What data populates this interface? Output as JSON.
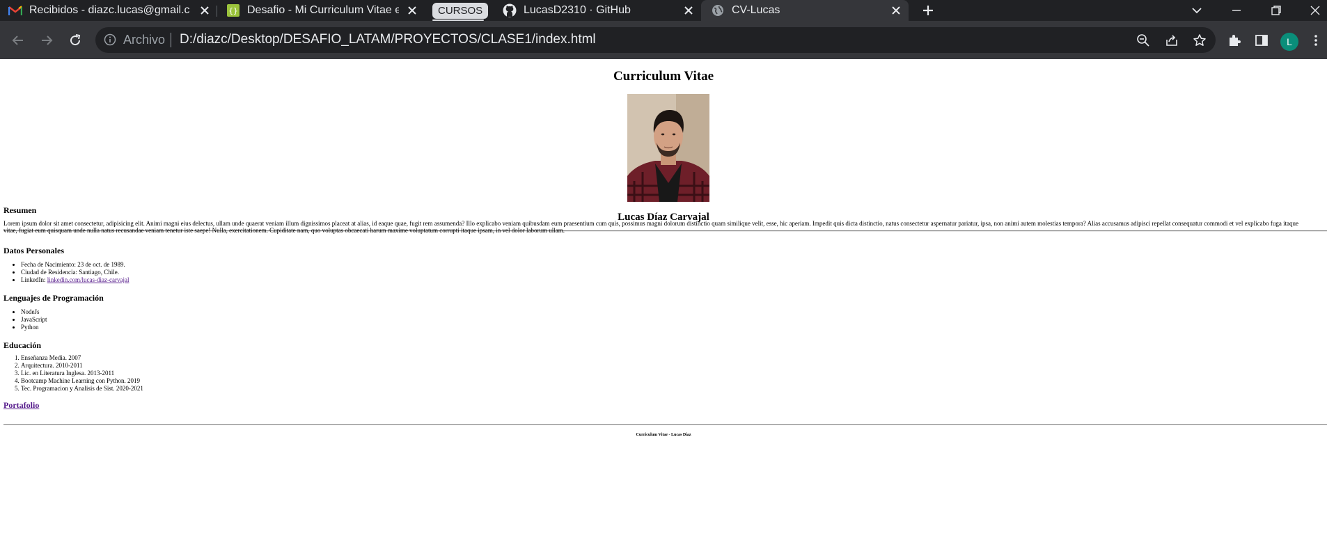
{
  "browser": {
    "tabs": [
      {
        "label": "Recibidos - diazc.lucas@gmail.com",
        "icon": "gmail-icon"
      },
      {
        "label": "Desafio - Mi Curriculum Vitae en",
        "icon": "desafio-latam-icon"
      },
      {
        "label": "LucasD2310 · GitHub",
        "icon": "github-icon"
      },
      {
        "label": "CV-Lucas",
        "icon": "globe-icon"
      }
    ],
    "tab_group_label": "CURSOS",
    "address": {
      "scheme_label": "Archivo",
      "url": "D:/diazc/Desktop/DESAFIO_LATAM/PROYECTOS/CLASE1/index.html"
    },
    "profile_initial": "L",
    "colors": {
      "tabbar": "#202124",
      "toolbar": "#35363a",
      "avatar": "#0a8e7a",
      "link_visited": "#551a8b"
    }
  },
  "cv": {
    "title": "Curriculum Vitae",
    "name": "Lucas Díaz Carvajal",
    "resumen": {
      "heading": "Resumen",
      "text": "Lorem ipsum dolor sit amet consectetur, adipisicing elit. Animi magni eius delectus, ullam unde quaerat veniam illum dignissimos placeat at alias, id eaque quae, fugit rem assumenda? Illo explicabo veniam quibusdam eum praesentium cum quis, possimus magni dolorum distinctio quam similique velit, esse, hic aperiam. Impedit quis dicta distinctio, natus consectetur aspernatur pariatur, ipsa, non animi autem molestias tempora? Alias accusamus adipisci repellat consequatur commodi et vel explicabo fuga itaque vitae, fugiat eum quisquam unde nulla natus recusandae veniam tenetur iste saepe! Nulla, exercitationem. Cupiditate nam, quo voluptas obcaecati harum maxime voluptatum corrupti itaque ipsam, in vel dolor laborum ullam."
    },
    "datos": {
      "heading": "Datos Personales",
      "nacimiento": "Fecha de Nacimiento: 23 de oct. de 1989.",
      "ciudad": "Ciudad de Residencia: Santiago, Chile.",
      "linkedin_label": "LinkedIn: ",
      "linkedin_link": "linkedin.com/lucas-diaz-carvajal"
    },
    "lenguajes": {
      "heading": "Lenguajes de Programación",
      "items": [
        "NodeJs",
        "JavaScript",
        "Python"
      ]
    },
    "educacion": {
      "heading": "Educación",
      "items": [
        "Enseñanza Media. 2007",
        "Arquitectura. 2010-2011",
        "Lic. en Literatura Inglesa. 2013-2011",
        "Bootcamp Machine Learning con Python. 2019",
        "Tec. Programacion y Analisis de Sist. 2020-2021"
      ]
    },
    "portafolio": "Portafolio",
    "footer": "Curriculum Vitae - Lucas Díaz"
  }
}
